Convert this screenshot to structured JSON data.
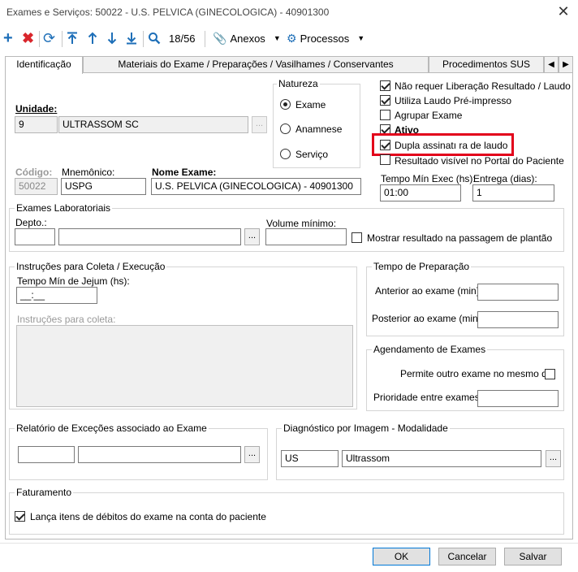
{
  "window": {
    "title": "Exames e Serviços: 50022 - U.S. PELVICA (GINECOLOGICA) - 40901300"
  },
  "toolbar": {
    "record_counter": "18/56",
    "anexos_label": "Anexos",
    "processos_label": "Processos"
  },
  "tabs": [
    {
      "label": "Identificação"
    },
    {
      "label": "Materiais do Exame / Preparações / Vasilhames / Conservantes"
    },
    {
      "label": "Procedimentos SUS"
    }
  ],
  "identificacao": {
    "unidade_label": "Unidade:",
    "unidade_code": "9",
    "unidade_name": "ULTRASSOM SC",
    "natureza": {
      "title": "Natureza",
      "options": [
        "Exame",
        "Anamnese",
        "Serviço"
      ],
      "selected": "Exame"
    },
    "options": [
      {
        "label": "Não requer Liberação Resultado / Laudo",
        "checked": true
      },
      {
        "label": "Utiliza Laudo Pré-impresso",
        "checked": true
      },
      {
        "label": "Agrupar Exame",
        "checked": false
      },
      {
        "label": "Ativo",
        "checked": true
      },
      {
        "label": "Dupla assinatı ra de laudo",
        "checked": true
      },
      {
        "label": "Resultado visível no Portal do Paciente",
        "checked": false
      }
    ],
    "codigo_label": "Código:",
    "codigo_value": "50022",
    "mnemonico_label": "Mnemônico:",
    "mnemonico_value": "USPG",
    "nome_label": "Nome Exame:",
    "nome_value": "U.S. PELVICA (GINECOLOGICA) - 40901300",
    "tempo_min_exec_label": "Tempo Mín Exec (hs):",
    "tempo_min_exec_value": "01:00",
    "entrega_label": "Entrega (dias):",
    "entrega_value": "1"
  },
  "laboratoriais": {
    "title": "Exames Laboratoriais",
    "depto_label": "Depto.:",
    "depto_code": "",
    "depto_name": "",
    "volume_label": "Volume mínimo:",
    "volume_value": "",
    "mostrar_label": "Mostrar resultado na passagem de plantão",
    "mostrar_checked": false
  },
  "instrucoes": {
    "title": "Instruções para Coleta / Execução",
    "jejum_label": "Tempo Mín de Jejum (hs):",
    "jejum_value": "__:__",
    "coleta_label": "Instruções para coleta:"
  },
  "preparacao": {
    "title": "Tempo de Preparação",
    "anterior_label": "Anterior ao exame (min):",
    "posterior_label": "Posterior ao exame (min):"
  },
  "agendamento": {
    "title": "Agendamento de Exames",
    "permite_label": "Permite outro exame no mesmo dia",
    "permite_checked": false,
    "prioridade_label": "Prioridade entre exames:"
  },
  "relatorio": {
    "title": "Relatório de Exceções associado ao Exame"
  },
  "diagnostico": {
    "title": "Diagnóstico por Imagem - Modalidade",
    "code": "US",
    "name": "Ultrassom"
  },
  "faturamento": {
    "title": "Faturamento",
    "lanca_label": "Lança itens de débitos do exame na conta do paciente",
    "lanca_checked": true
  },
  "buttons": {
    "ok": "OK",
    "cancelar": "Cancelar",
    "salvar": "Salvar"
  }
}
